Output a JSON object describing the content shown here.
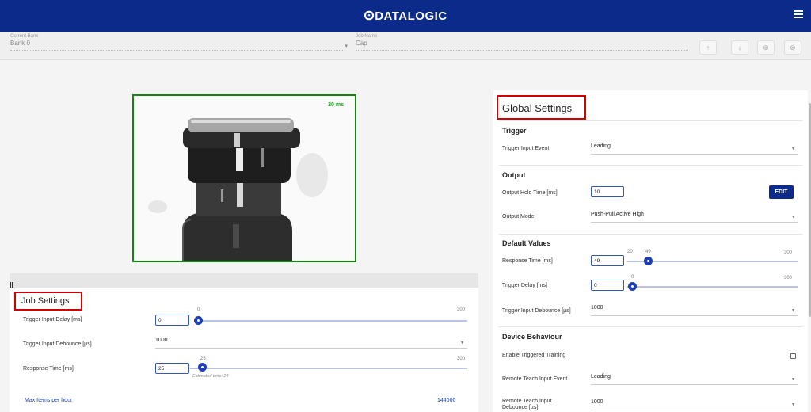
{
  "header": {
    "brand": "ⵙDATALOGIC",
    "menu_icon": "hamburger-icon"
  },
  "toolbar": {
    "current_bank_label": "Current Bank",
    "current_bank_value": "Bank 0",
    "job_name_label": "Job Name",
    "job_name_value": "Cap",
    "buttons": [
      "↑",
      "↓",
      "⊕",
      "⊗"
    ]
  },
  "camera": {
    "timing": "20 ms"
  },
  "job_settings": {
    "title": "Job Settings",
    "trigger_input_delay": {
      "label": "Trigger Input Delay [ms]",
      "value": "0",
      "slider_min": "0",
      "slider_max": "300",
      "slider_value": "0"
    },
    "trigger_input_debounce": {
      "label": "Trigger Input Debounce [µs]",
      "value": "1000"
    },
    "response_time": {
      "label": "Response Time [ms]",
      "value": "25",
      "slider_value": "25",
      "slider_max": "300",
      "hint": "Estimated time: 24"
    },
    "max_items": {
      "label": "Max Items per hour",
      "value": "144000"
    }
  },
  "global_settings": {
    "title": "Global Settings",
    "trigger": {
      "heading": "Trigger",
      "input_event_label": "Trigger Input Event",
      "input_event_value": "Leading"
    },
    "output": {
      "heading": "Output",
      "hold_time_label": "Output Hold Time [ms]",
      "hold_time_value": "10",
      "edit_label": "EDIT",
      "mode_label": "Output Mode",
      "mode_value": "Push-Pull Active High"
    },
    "default_values": {
      "heading": "Default Values",
      "response_time_label": "Response Time [ms]",
      "response_time_value": "49",
      "response_slider_min": "20",
      "response_slider_value": "49",
      "response_slider_max": "300",
      "trigger_delay_label": "Trigger Delay [ms]",
      "trigger_delay_value": "0",
      "delay_slider_value": "0",
      "delay_slider_max": "300",
      "debounce_label": "Trigger Input Debounce [µs]",
      "debounce_value": "1000"
    },
    "device_behaviour": {
      "heading": "Device Behaviour",
      "triggered_training_label": "Enable Triggered Training",
      "remote_teach_event_label": "Remote Teach Input Event",
      "remote_teach_event_value": "Leading",
      "remote_teach_debounce_label_1": "Remote Teach Input",
      "remote_teach_debounce_label_2": "Debounce [µs]",
      "remote_teach_debounce_value": "1000"
    }
  }
}
